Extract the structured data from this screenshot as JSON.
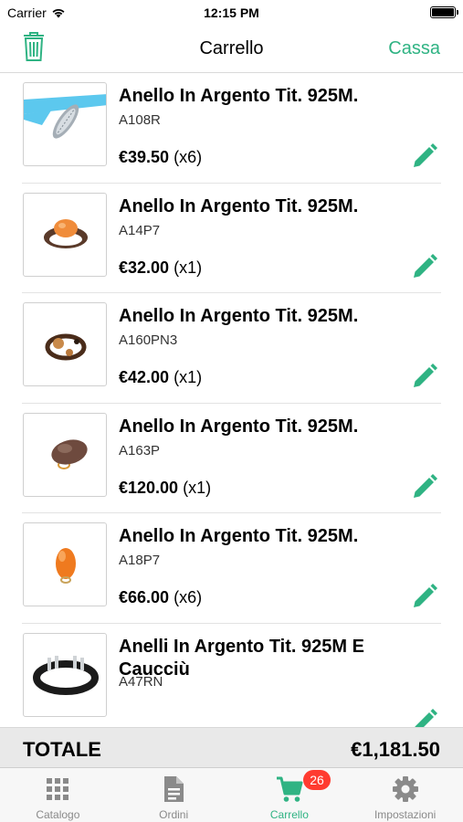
{
  "status_bar": {
    "carrier": "Carrier",
    "time": "12:15 PM",
    "icons": [
      "wifi-icon",
      "battery-icon"
    ]
  },
  "nav": {
    "title": "Carrello",
    "action_label": "Cassa",
    "left_icon": "trash-icon"
  },
  "colors": {
    "accent": "#2fb383",
    "badge": "#ff3b30",
    "total_bg": "#e9e9e9"
  },
  "items": [
    {
      "name": "Anello In Argento Tit. 925M.",
      "code": "A108R",
      "price": "€39.50",
      "qty": "(x6)"
    },
    {
      "name": "Anello In Argento Tit. 925M.",
      "code": "A14P7",
      "price": "€32.00",
      "qty": "(x1)"
    },
    {
      "name": "Anello In Argento Tit. 925M.",
      "code": "A160PN3",
      "price": "€42.00",
      "qty": "(x1)"
    },
    {
      "name": "Anello In Argento Tit. 925M.",
      "code": "A163P",
      "price": "€120.00",
      "qty": "(x1)"
    },
    {
      "name": "Anello In Argento Tit. 925M.",
      "code": "A18P7",
      "price": "€66.00",
      "qty": "(x6)"
    },
    {
      "name": "Anelli In Argento Tit. 925M E Caucciù",
      "code": "A47RN"
    }
  ],
  "total": {
    "label": "TOTALE",
    "value": "€1,181.50"
  },
  "tabs": [
    {
      "label": "Catalogo",
      "icon": "grid-icon"
    },
    {
      "label": "Ordini",
      "icon": "document-icon"
    },
    {
      "label": "Carrello",
      "icon": "cart-icon",
      "badge": "26",
      "active": true
    },
    {
      "label": "Impostazioni",
      "icon": "gear-icon"
    }
  ]
}
